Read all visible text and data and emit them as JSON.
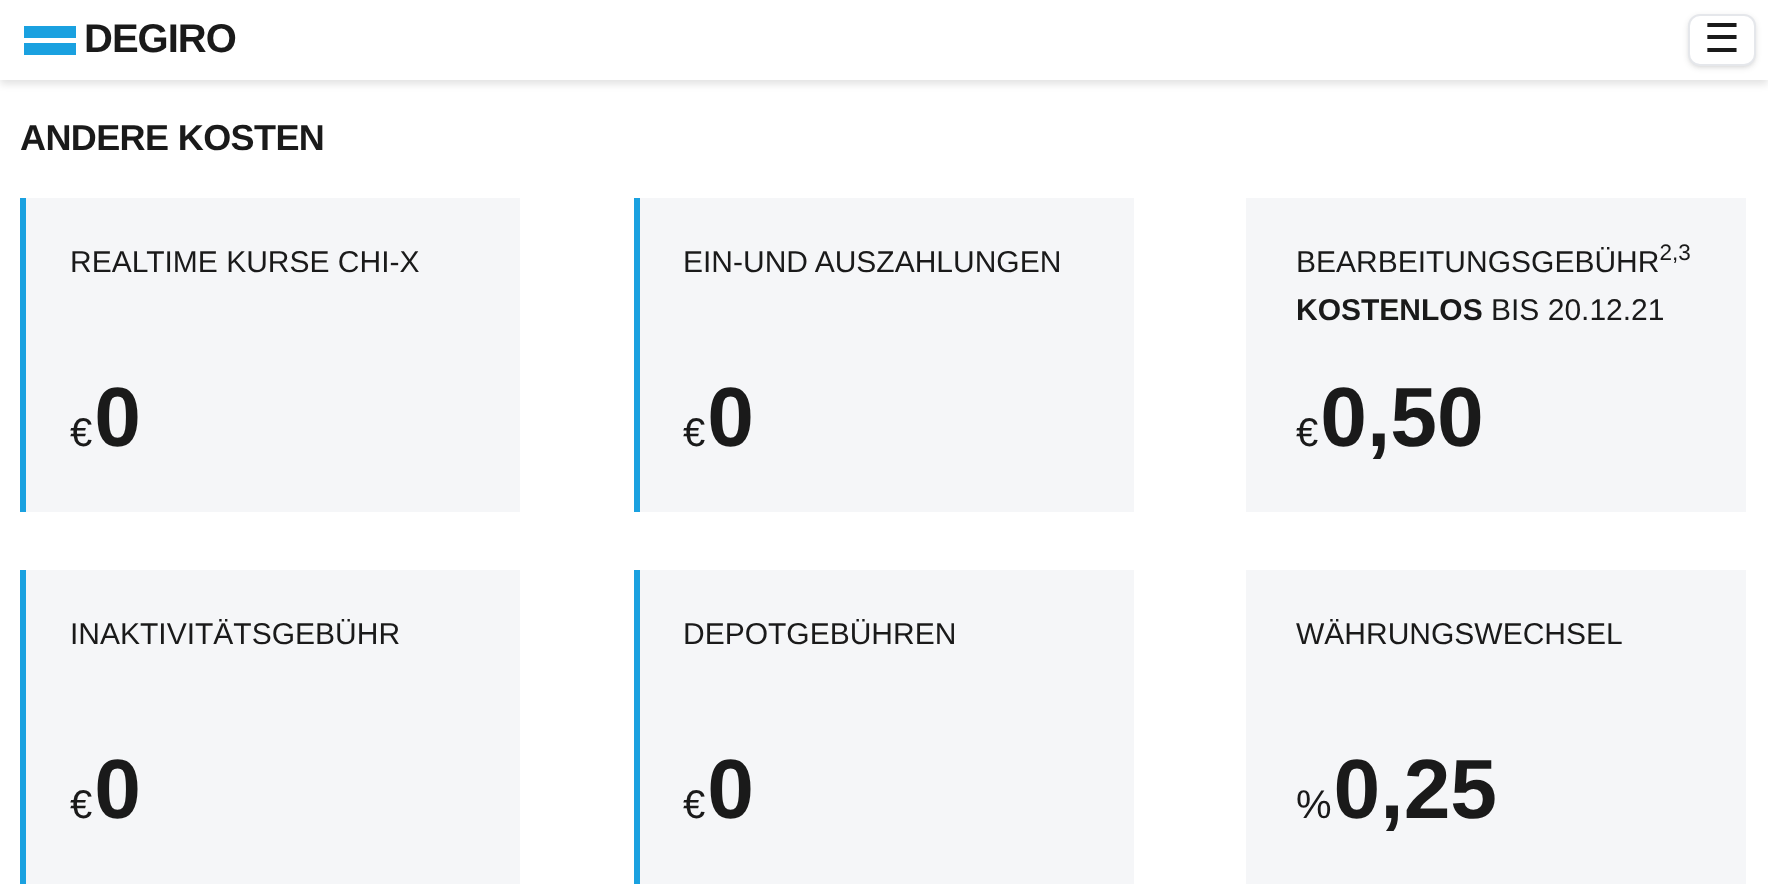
{
  "header": {
    "logo": "DEGIRO",
    "menu_button": "☰"
  },
  "section_title": "ANDERE KOSTEN",
  "cards": [
    {
      "title": "REALTIME KURSE CHI-X",
      "unit": "€",
      "amount": "0",
      "highlighted": true
    },
    {
      "title": "EIN-UND AUSZAHLUNGEN",
      "unit": "€",
      "amount": "0",
      "highlighted": true
    },
    {
      "title": "BEARBEITUNGSGEBÜHR$^{2,3}$",
      "note": "**KOSTENLOS** BIS 20.12.21",
      "unit": "€",
      "amount": "0,50",
      "highlighted": false
    },
    {
      "title": "INAKTIVITÄTSGEBÜHR",
      "unit": "€",
      "amount": "0",
      "highlighted": true
    },
    {
      "title": "DEPOTGEBÜHREN",
      "unit": "€",
      "amount": "0",
      "highlighted": true
    },
    {
      "title": "WÄHRUNGSWECHSEL",
      "unit": "%",
      "amount": "0,25",
      "highlighted": false
    }
  ]
}
